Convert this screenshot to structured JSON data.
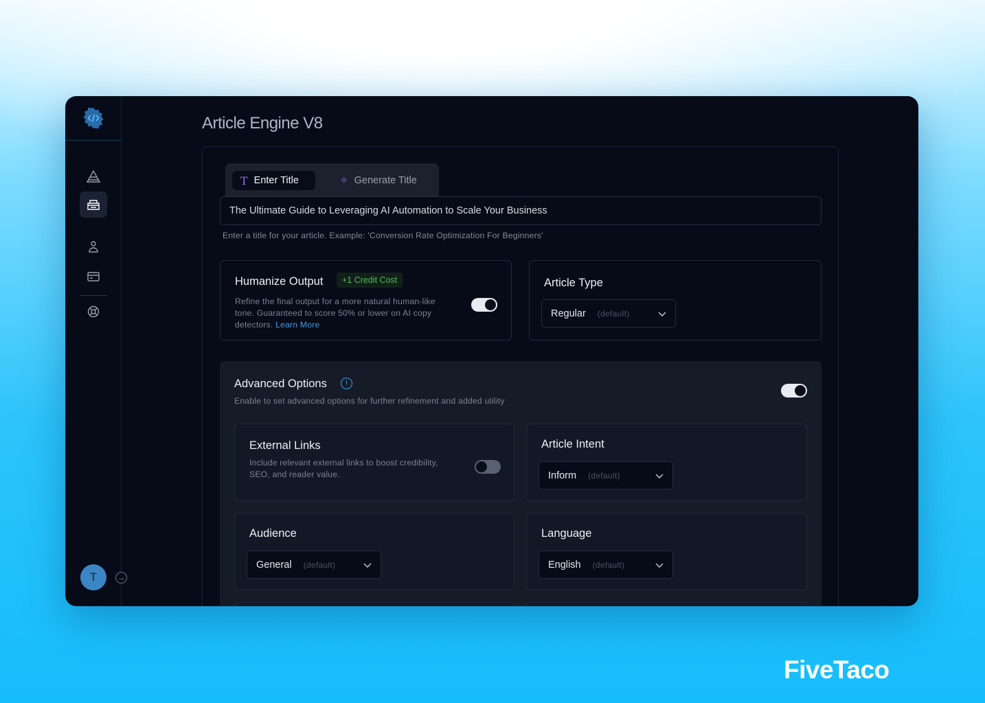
{
  "app": {
    "title": "Article Engine V8"
  },
  "sidebar": {
    "items": [
      {
        "icon": "pyramid-icon",
        "active": false
      },
      {
        "icon": "typewriter-icon",
        "active": true
      },
      {
        "icon": "user-icon",
        "active": false
      },
      {
        "icon": "credit-card-icon",
        "active": false
      },
      {
        "icon": "lifebuoy-icon",
        "active": false
      }
    ],
    "avatar": "T"
  },
  "title_tabs": [
    {
      "label": "Enter Title",
      "icon": "text-icon",
      "active": true
    },
    {
      "label": "Generate Title",
      "icon": "sparkles-icon",
      "active": false
    }
  ],
  "title_input": {
    "value": "The Ultimate Guide to Leveraging AI Automation to Scale Your Business",
    "hint": "Enter a title for your article. Example: 'Conversion Rate Optimization For Beginners'"
  },
  "humanize": {
    "title": "Humanize Output",
    "badge": "+1 Credit Cost",
    "desc": "Refine the final output for a more natural human-like tone. Guaranteed to score 50% or lower on AI copy detectors.",
    "link": "Learn More",
    "enabled": true
  },
  "article_type": {
    "title": "Article Type",
    "value": "Regular",
    "default_label": "(default)"
  },
  "advanced": {
    "title": "Advanced Options",
    "desc": "Enable to set advanced options for further refinement and added utility",
    "enabled": true,
    "external_links": {
      "title": "External Links",
      "desc": "Include relevant external links to boost credibility, SEO, and reader value.",
      "enabled": false
    },
    "intent": {
      "title": "Article Intent",
      "value": "Inform",
      "default_label": "(default)"
    },
    "audience": {
      "title": "Audience",
      "value": "General",
      "default_label": "(default)"
    },
    "language": {
      "title": "Language",
      "value": "English",
      "default_label": "(default)"
    }
  },
  "brand": {
    "watermark": "FiveTaco"
  },
  "colors": {
    "accent": "#3f9ee8",
    "badge_green": "#4fb85a",
    "purple": "#9b6cf0",
    "window_bg": "#070b18"
  }
}
